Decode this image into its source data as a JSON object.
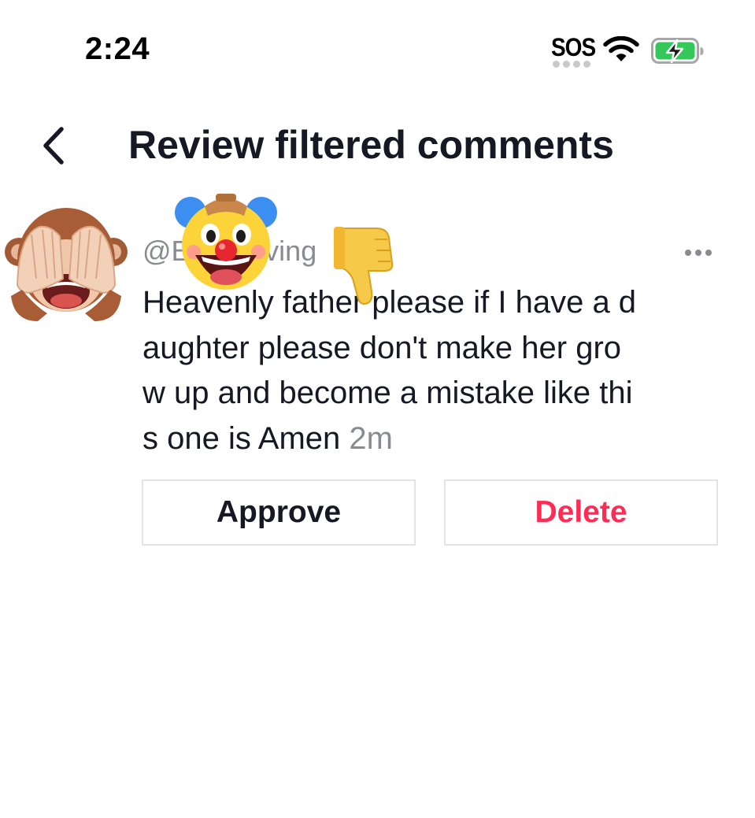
{
  "status_bar": {
    "time": "2:24",
    "sos": "SOS",
    "wifi_icon": "wifi-icon",
    "battery_icon": "battery-charging-icon",
    "battery_color": "#34c759"
  },
  "header": {
    "back_icon": "chevron-left-icon",
    "title": "Review filtered comments"
  },
  "comment": {
    "avatar_icon": "see-no-evil-monkey-icon",
    "meta": "@E  h • F      ving",
    "more_icon": "ellipsis-icon",
    "body_lines": [
      "Heavenly father please if I have a d",
      "aughter please don't make her gro",
      "w up and become a mistake like thi",
      "s one is Amen "
    ],
    "time": "2m",
    "stickers": [
      "clown-face-icon",
      "thumbs-down-icon"
    ]
  },
  "actions": {
    "approve_label": "Approve",
    "delete_label": "Delete",
    "delete_color": "#fe2c55"
  }
}
